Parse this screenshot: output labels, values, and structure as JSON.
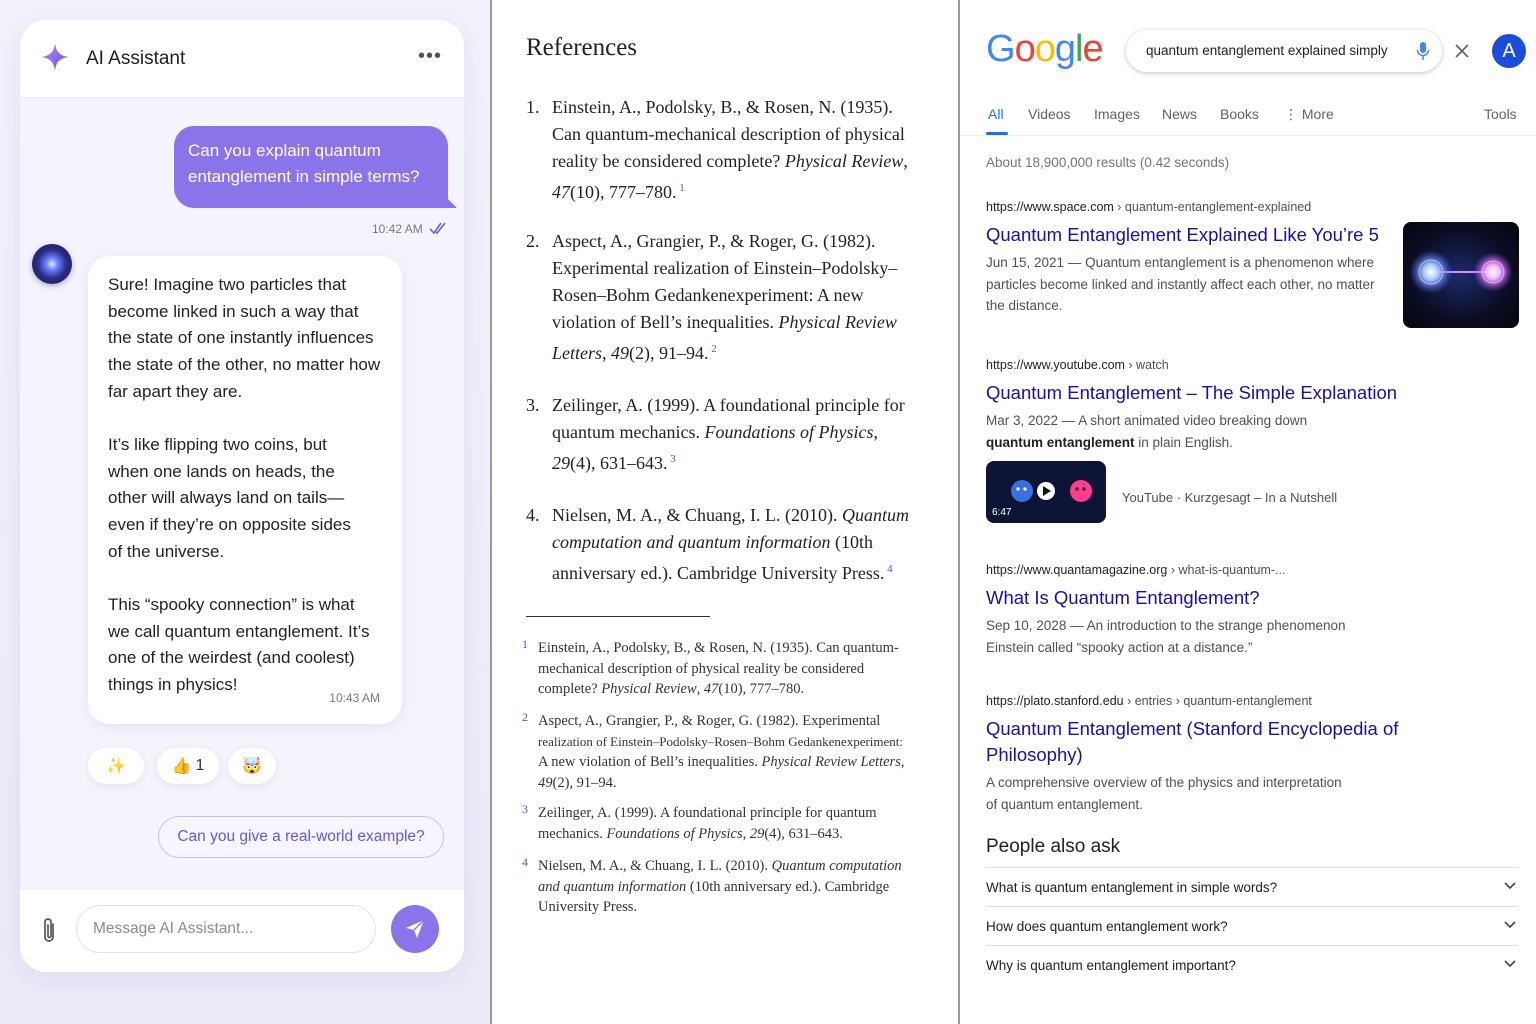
{
  "chat": {
    "title": "AI Assistant",
    "more": "•••",
    "user_message": "Can you explain quantum entanglement in simple terms?",
    "user_time": "10:42 AM",
    "bot_paragraphs": [
      "Sure! Imagine two particles that\nbecome linked in such a way that\nthe state of one instantly influences\nthe state of the other, no matter how\nfar apart they are.",
      "It’s like flipping two coins, but\nwhen one lands on heads, the\nother will always land on tails—\neven if they’re on opposite sides\nof the universe.",
      "This “spooky connection” is what\nwe call quantum entanglement. It’s\none of the weirdest (and coolest)\nthings in physics!"
    ],
    "bot_time": "10:43 AM",
    "reactions": [
      {
        "emoji": "✨",
        "count": ""
      },
      {
        "emoji": "👍",
        "count": "1"
      },
      {
        "emoji": "🤯",
        "count": ""
      }
    ],
    "suggestion": "Can you give a real-world example?",
    "input_placeholder": "Message AI Assistant...",
    "accent": "#8b74ea"
  },
  "references": {
    "title": "References",
    "entries": [
      {
        "num": "1.",
        "sup": "1",
        "html": "Einstein, A., Podolsky, B., &amp; Rosen, N. (1935).<br>Can quantum-mechanical description of physical<br>reality be considered complete? <i>Physical Review</i>,<br><i>47</i>(10), 777–780."
      },
      {
        "num": "2.",
        "sup": "2",
        "html": "Aspect, A., Grangier, P., &amp; Roger, G. (1982).<br>Experimental realization of Einstein–Podolsky–<br>Rosen–Bohm Gedankenexperiment: A new<br>violation of Bell’s inequalities. <i>Physical Review</i><br><i>Letters</i>, <i>49</i>(2), 91–94."
      },
      {
        "num": "3.",
        "sup": "3",
        "html": "Zeilinger, A. (1999). A foundational principle for<br>quantum mechanics. <i>Foundations of Physics</i>,<br><i>29</i>(4), 631–643."
      },
      {
        "num": "4.",
        "sup": "4",
        "html": "Nielsen, M. A., &amp; Chuang, I. L. (2010). <i>Quantum</i><br><i>computation and quantum information</i> (10th<br>anniversary ed.). Cambridge University Press."
      }
    ],
    "footnotes": [
      {
        "num": "1",
        "html": "Einstein, A., Podolsky, B., &amp; Rosen, N. (1935). Can quantum-<br>mechanical description of physical reality be considered<br>complete? <i>Physical Review</i>, <i>47</i>(10), 777–780."
      },
      {
        "num": "2",
        "html": "Aspect, A., Grangier, P., &amp; Roger, G. (1982). Experimental<br><span style=\"font-size:13px\">realization of Einstein–Podolsky–Rosen–Bohm Gedankenexperiment:</span><br>A new violation of Bell’s inequalities. <i>Physical Review Letters</i>,<br><i>49</i>(2), 91–94."
      },
      {
        "num": "3",
        "html": "Zeilinger, A. (1999). A foundational principle for quantum<br>mechanics. <i>Foundations of Physics</i>, <i>29</i>(4), 631–643."
      },
      {
        "num": "4",
        "html": "Nielsen, M. A., &amp; Chuang, I. L. (2010). <i>Quantum computation</i><br><i>and quantum information</i> (10th anniversary ed.). Cambridge<br>University Press."
      }
    ]
  },
  "google": {
    "logo_letters": [
      {
        "ch": "G",
        "color": "#4285F4"
      },
      {
        "ch": "o",
        "color": "#EA4335"
      },
      {
        "ch": "o",
        "color": "#FBBC05"
      },
      {
        "ch": "g",
        "color": "#4285F4"
      },
      {
        "ch": "l",
        "color": "#34A853"
      },
      {
        "ch": "e",
        "color": "#EA4335"
      }
    ],
    "query": "quantum entanglement explained simply",
    "avatar": "A",
    "tabs": [
      "All",
      "Videos",
      "Images",
      "News",
      "Books",
      "⋮ More",
      "Tools"
    ],
    "stats": "About 18,900,000 results (0.42 seconds)",
    "results": [
      {
        "url": "https://www.space.com",
        "path": " › quantum-entanglement-explained",
        "title": "Quantum Entanglement Explained Like You’re 5",
        "snippet": "Jun 15, 2021 — Quantum entanglement is a phenomenon where<br>particles become linked and instantly affect each other, no matter<br>the distance."
      },
      {
        "url": "https://www.youtube.com",
        "path": " › watch",
        "title": "Quantum Entanglement – The Simple Explanation",
        "snippet": "Mar 3, 2022 — A short animated video breaking down<br><b>quantum entanglement</b> in plain English."
      },
      {
        "url": "https://www.quantamagazine.org",
        "path": " › what-is-quantum-...",
        "title": "What Is Quantum Entanglement?",
        "snippet": "Sep 10, 2028 — An introduction to the strange phenomenon<br>Einstein called “spooky action at a distance.”"
      },
      {
        "url": "https://plato.stanford.edu",
        "path": " › entries › quantum-entanglement",
        "title": "Quantum Entanglement (Stanford Encyclopedia of<br>Philosophy)",
        "snippet": "A comprehensive overview of the physics and interpretation<br>of quantum entanglement."
      }
    ],
    "video": {
      "duration": "6:47",
      "source": "YouTube · Kurzgesagt – In a Nutshell"
    },
    "paa_title": "People also ask",
    "paa": [
      "What is quantum entanglement in simple words?",
      "How does quantum entanglement work?",
      "Why is quantum entanglement important?"
    ]
  }
}
